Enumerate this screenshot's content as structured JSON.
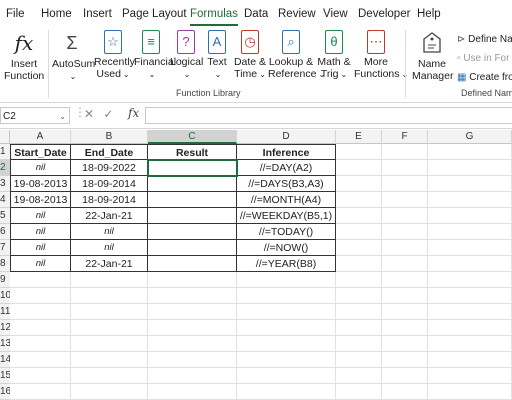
{
  "tabs": [
    "File",
    "Home",
    "Insert",
    "Page Layout",
    "Formulas",
    "Data",
    "Review",
    "View",
    "Developer",
    "Help"
  ],
  "active_tab": "Formulas",
  "ribbon": {
    "insert_function": [
      "Insert",
      "Function"
    ],
    "library": [
      {
        "l1": "AutoSum",
        "l2": "",
        "icon": "sigma-icon"
      },
      {
        "l1": "Recently",
        "l2": "Used",
        "icon": "star-book-icon"
      },
      {
        "l1": "Financial",
        "l2": "",
        "icon": "database-book-icon"
      },
      {
        "l1": "Logical",
        "l2": "",
        "icon": "question-book-icon"
      },
      {
        "l1": "Text",
        "l2": "",
        "icon": "text-book-icon"
      },
      {
        "l1": "Date &",
        "l2": "Time",
        "icon": "clock-book-icon"
      },
      {
        "l1": "Lookup &",
        "l2": "Reference",
        "icon": "magnifier-book-icon"
      },
      {
        "l1": "Math &",
        "l2": "Trig",
        "icon": "theta-book-icon"
      },
      {
        "l1": "More",
        "l2": "Functions",
        "icon": "more-book-icon"
      }
    ],
    "library_label": "Function Library",
    "name_manager": [
      "Name",
      "Manager"
    ],
    "define_name": "Define Nam",
    "use_in_formula": "Use in For",
    "create_from": "Create fro",
    "defined_names_label": "Defined Names"
  },
  "formula_bar": {
    "name_box": "C2",
    "fx": "fx",
    "value": ""
  },
  "columns": [
    "A",
    "B",
    "C",
    "D",
    "E",
    "F",
    "G"
  ],
  "rows": [
    "1",
    "2",
    "3",
    "4",
    "5",
    "6",
    "7",
    "8",
    "9",
    "10",
    "11",
    "12",
    "13",
    "14",
    "15",
    "16"
  ],
  "table": {
    "headers": [
      "Start_Date",
      "End_Date",
      "Result",
      "Inference"
    ],
    "rows": [
      [
        "nil",
        "18-09-2022",
        "",
        "//=DAY(A2)"
      ],
      [
        "19-08-2013",
        "18-09-2014",
        "",
        "//=DAYS(B3,A3)"
      ],
      [
        "19-08-2013",
        "18-09-2014",
        "",
        "//=MONTH(A4)"
      ],
      [
        "nil",
        "22-Jan-21",
        "",
        "//=WEEKDAY(B5,1)"
      ],
      [
        "nil",
        "nil",
        "",
        "//=TODAY()"
      ],
      [
        "nil",
        "nil",
        "",
        "//=NOW()"
      ],
      [
        "nil",
        "22-Jan-21",
        "",
        "//=YEAR(B8)"
      ]
    ]
  },
  "selected_cell": "C2",
  "accent_color": "#1e6b3c"
}
